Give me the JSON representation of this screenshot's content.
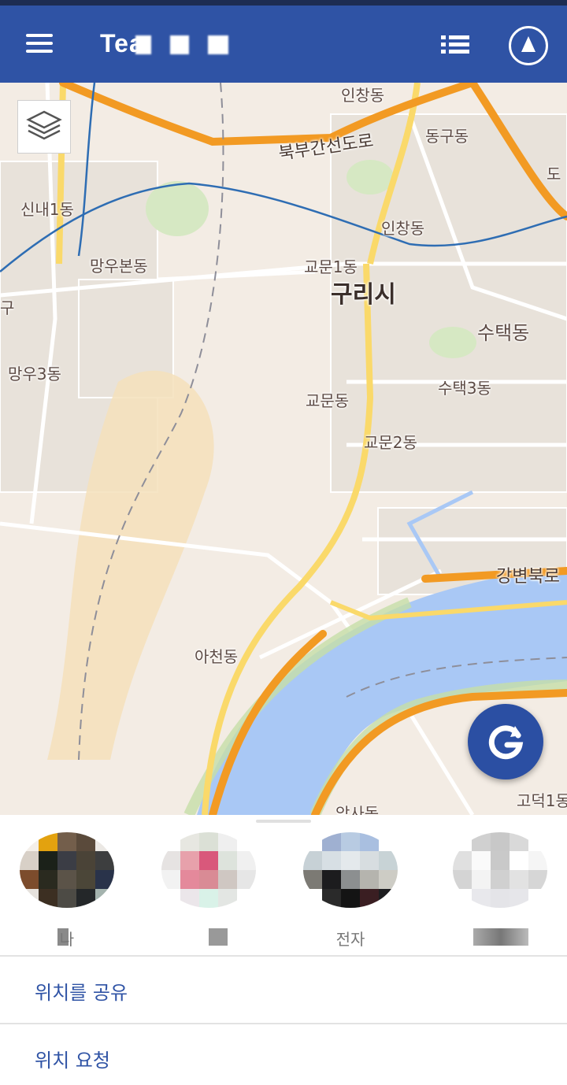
{
  "app_bar": {
    "title": "Tea",
    "menu_icon": "hamburger-menu-icon",
    "list_icon": "list-icon",
    "nav_icon": "navigation-arrow-icon"
  },
  "map": {
    "layers_icon": "layers-icon",
    "refresh_icon": "refresh-g-icon",
    "labels": [
      {
        "text": "인창동"
      },
      {
        "text": "북부간선도로"
      },
      {
        "text": "동구동"
      },
      {
        "text": "도"
      },
      {
        "text": "신내1동"
      },
      {
        "text": "인창동"
      },
      {
        "text": "망우본동"
      },
      {
        "text": "교문1동"
      },
      {
        "text": "구리시"
      },
      {
        "text": "구"
      },
      {
        "text": "수택동"
      },
      {
        "text": "망우3동"
      },
      {
        "text": "교문동"
      },
      {
        "text": "수택3동"
      },
      {
        "text": "교문2동"
      },
      {
        "text": "강변북로"
      },
      {
        "text": "아천동"
      },
      {
        "text": "고덕1동"
      },
      {
        "text": "암사동"
      }
    ]
  },
  "members": [
    {
      "name": "나"
    },
    {
      "name": ""
    },
    {
      "name": "전자"
    },
    {
      "name": ""
    }
  ],
  "actions": {
    "share_location": "위치를 공유",
    "request_location": "위치 요청"
  },
  "colors": {
    "app_bar": "#2f53a5",
    "accent": "#2b4fa3",
    "map_background": "#f3ece4",
    "river": "#a9c8f5",
    "highway": "#f29a23",
    "road_yellow": "#fad96a"
  }
}
